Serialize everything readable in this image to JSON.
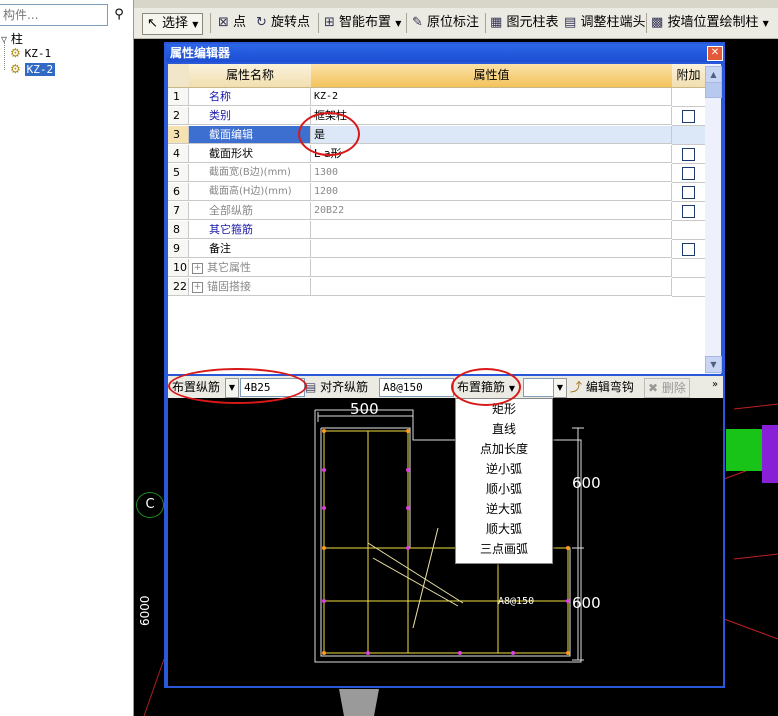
{
  "left_panel": {
    "search_placeholder": "构件...",
    "tree_root": "柱",
    "tree_items": [
      "KZ-1",
      "KZ-2"
    ]
  },
  "toolbar": {
    "select": "选择",
    "point": "点",
    "rotate_point": "旋转点",
    "smart_layout": "智能布置",
    "original_label": "原位标注",
    "element_table": "图元柱表",
    "adjust_end": "调整柱端头",
    "draw_by_wall": "按墙位置绘制柱"
  },
  "dialog": {
    "title": "属性编辑器",
    "columns": [
      "属性名称",
      "属性值",
      "附加"
    ],
    "rows": [
      {
        "num": "1",
        "name": "名称",
        "value": "KZ-2",
        "check": false
      },
      {
        "num": "2",
        "name": "类别",
        "value": "框架柱",
        "check": true
      },
      {
        "num": "3",
        "name": "截面编辑",
        "value": "是",
        "check": false
      },
      {
        "num": "4",
        "name": "截面形状",
        "value": "L-a形",
        "check": true
      },
      {
        "num": "5",
        "name": "截面宽(B边)(mm)",
        "value": "1300",
        "check": true
      },
      {
        "num": "6",
        "name": "截面高(H边)(mm)",
        "value": "1200",
        "check": true
      },
      {
        "num": "7",
        "name": "全部纵筋",
        "value": "20B22",
        "check": true
      },
      {
        "num": "8",
        "name": "其它箍筋",
        "value": "",
        "check": false
      },
      {
        "num": "9",
        "name": "备注",
        "value": "",
        "check": true
      },
      {
        "num": "10",
        "name": "其它属性",
        "value": "",
        "check": false
      },
      {
        "num": "22",
        "name": "锚固搭接",
        "value": "",
        "check": false
      }
    ]
  },
  "bottom_toolbar": {
    "place_longitudinal": "布置纵筋",
    "longitudinal_value": "4B25",
    "align_longitudinal": "对齐纵筋",
    "stirrup_value": "A8@150",
    "place_stirrup": "布置箍筋",
    "edit_hook": "编辑弯钩",
    "delete": "删除"
  },
  "stirrup_menu": [
    "矩形",
    "直线",
    "点加长度",
    "逆小弧",
    "顺小弧",
    "逆大弧",
    "顺大弧",
    "三点画弧"
  ],
  "drawing": {
    "dim_top": "500",
    "dim_right_upper": "600",
    "dim_right_lower": "600",
    "stirrup_label": "A8@150",
    "axis_label": "C",
    "left_dim": "6000"
  }
}
